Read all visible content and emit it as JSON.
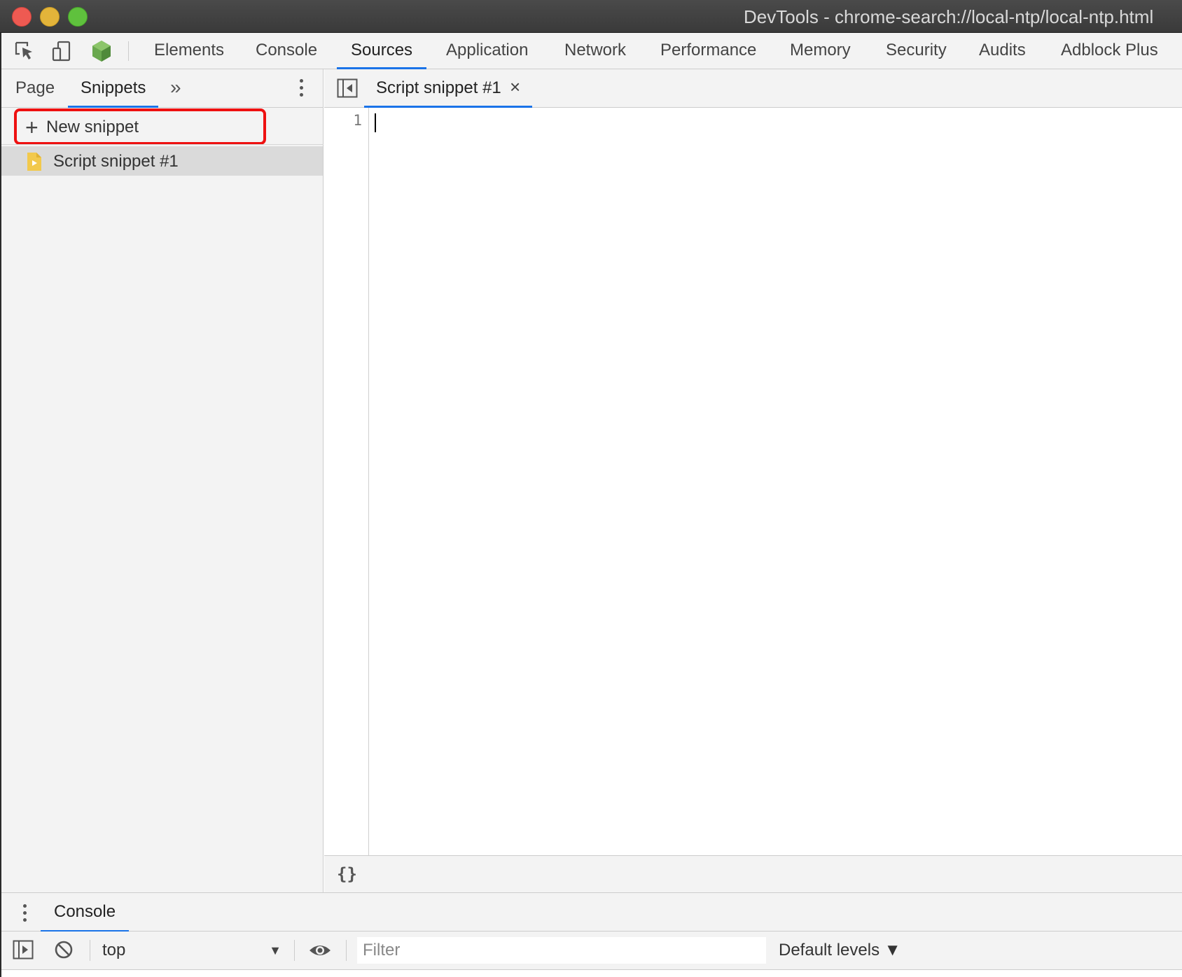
{
  "window": {
    "title": "DevTools - chrome-search://local-ntp/local-ntp.html"
  },
  "toolbar": {
    "tabs": [
      {
        "label": "Elements",
        "active": false
      },
      {
        "label": "Console",
        "active": false
      },
      {
        "label": "Sources",
        "active": true
      },
      {
        "label": "Application",
        "active": false
      },
      {
        "label": "Network",
        "active": false
      },
      {
        "label": "Performance",
        "active": false
      },
      {
        "label": "Memory",
        "active": false
      },
      {
        "label": "Security",
        "active": false
      },
      {
        "label": "Audits",
        "active": false
      },
      {
        "label": "Adblock Plus",
        "active": false
      }
    ],
    "icons": [
      "inspect-element-icon",
      "device-toolbar-icon",
      "nodejs-icon"
    ]
  },
  "navigator": {
    "tabs": [
      {
        "label": "Page",
        "active": false
      },
      {
        "label": "Snippets",
        "active": true
      }
    ],
    "more_tabs_glyph": "»",
    "new_snippet_label": "New snippet",
    "new_snippet_plus": "+",
    "files": [
      {
        "label": "Script snippet #1",
        "selected": true
      }
    ]
  },
  "editor": {
    "open_tab": {
      "label": "Script snippet #1",
      "close_glyph": "×"
    },
    "line_numbers": [
      "1"
    ],
    "footer_pretty_print": "{}"
  },
  "drawer": {
    "tab_label": "Console",
    "context_value": "top",
    "context_caret": "▼",
    "filter_placeholder": "Filter",
    "levels_label": "Default levels ▼"
  },
  "colors": {
    "active_tab_underline": "#1a73e8",
    "highlight_box": "#ee1111",
    "titlebar": "#3a3a3a",
    "panel_bg": "#f3f3f3"
  }
}
